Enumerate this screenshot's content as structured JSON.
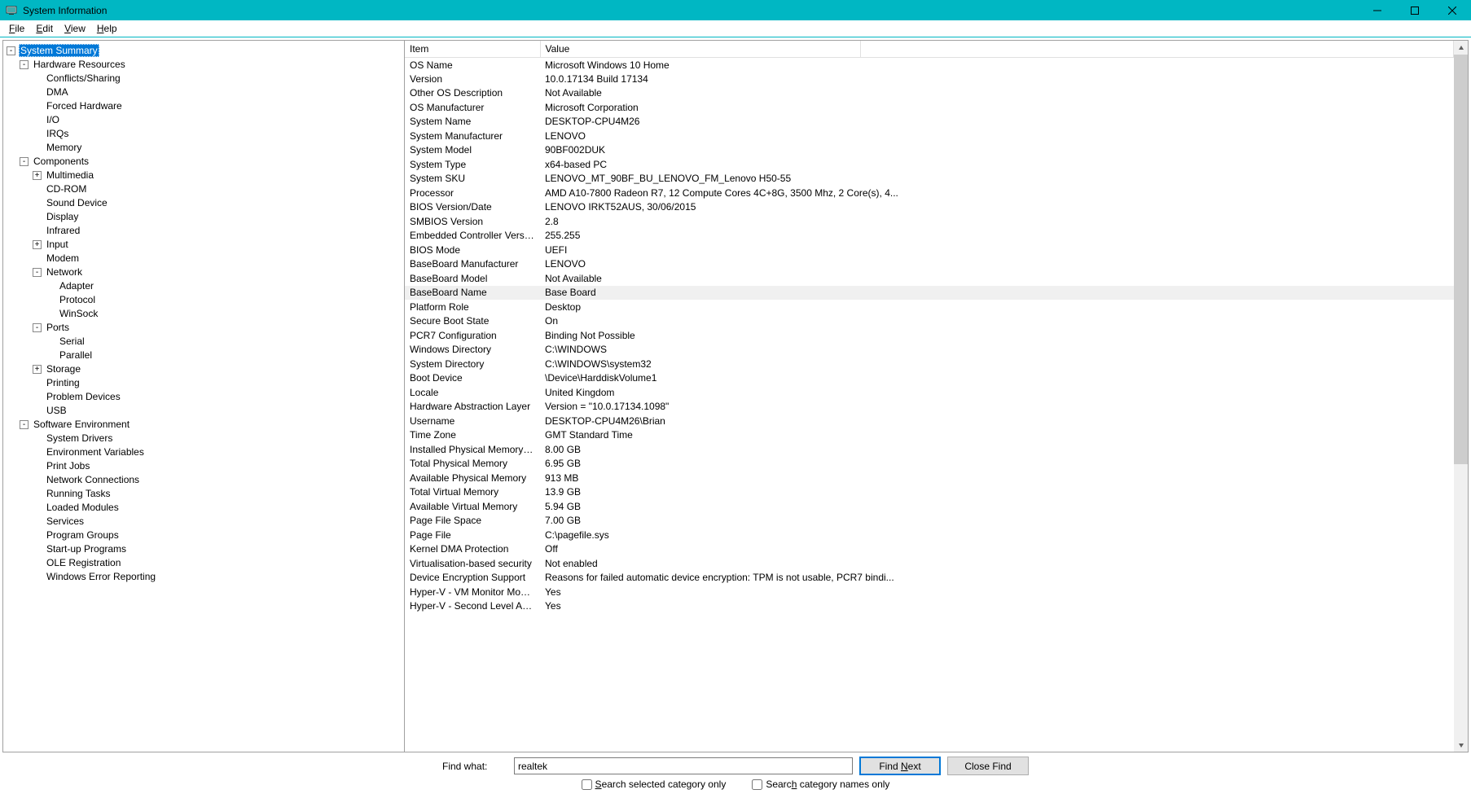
{
  "window": {
    "title": "System Information"
  },
  "menu": {
    "file": "File",
    "edit": "Edit",
    "view": "View",
    "help": "Help"
  },
  "tree": [
    {
      "depth": 0,
      "expander": "-",
      "label": "System Summary",
      "selected": true
    },
    {
      "depth": 1,
      "expander": "-",
      "label": "Hardware Resources"
    },
    {
      "depth": 2,
      "expander": "",
      "label": "Conflicts/Sharing"
    },
    {
      "depth": 2,
      "expander": "",
      "label": "DMA"
    },
    {
      "depth": 2,
      "expander": "",
      "label": "Forced Hardware"
    },
    {
      "depth": 2,
      "expander": "",
      "label": "I/O"
    },
    {
      "depth": 2,
      "expander": "",
      "label": "IRQs"
    },
    {
      "depth": 2,
      "expander": "",
      "label": "Memory"
    },
    {
      "depth": 1,
      "expander": "-",
      "label": "Components"
    },
    {
      "depth": 2,
      "expander": "+",
      "label": "Multimedia"
    },
    {
      "depth": 2,
      "expander": "",
      "label": "CD-ROM"
    },
    {
      "depth": 2,
      "expander": "",
      "label": "Sound Device"
    },
    {
      "depth": 2,
      "expander": "",
      "label": "Display"
    },
    {
      "depth": 2,
      "expander": "",
      "label": "Infrared"
    },
    {
      "depth": 2,
      "expander": "+",
      "label": "Input"
    },
    {
      "depth": 2,
      "expander": "",
      "label": "Modem"
    },
    {
      "depth": 2,
      "expander": "-",
      "label": "Network"
    },
    {
      "depth": 3,
      "expander": "",
      "label": "Adapter"
    },
    {
      "depth": 3,
      "expander": "",
      "label": "Protocol"
    },
    {
      "depth": 3,
      "expander": "",
      "label": "WinSock"
    },
    {
      "depth": 2,
      "expander": "-",
      "label": "Ports"
    },
    {
      "depth": 3,
      "expander": "",
      "label": "Serial"
    },
    {
      "depth": 3,
      "expander": "",
      "label": "Parallel"
    },
    {
      "depth": 2,
      "expander": "+",
      "label": "Storage"
    },
    {
      "depth": 2,
      "expander": "",
      "label": "Printing"
    },
    {
      "depth": 2,
      "expander": "",
      "label": "Problem Devices"
    },
    {
      "depth": 2,
      "expander": "",
      "label": "USB"
    },
    {
      "depth": 1,
      "expander": "-",
      "label": "Software Environment"
    },
    {
      "depth": 2,
      "expander": "",
      "label": "System Drivers"
    },
    {
      "depth": 2,
      "expander": "",
      "label": "Environment Variables"
    },
    {
      "depth": 2,
      "expander": "",
      "label": "Print Jobs"
    },
    {
      "depth": 2,
      "expander": "",
      "label": "Network Connections"
    },
    {
      "depth": 2,
      "expander": "",
      "label": "Running Tasks"
    },
    {
      "depth": 2,
      "expander": "",
      "label": "Loaded Modules"
    },
    {
      "depth": 2,
      "expander": "",
      "label": "Services"
    },
    {
      "depth": 2,
      "expander": "",
      "label": "Program Groups"
    },
    {
      "depth": 2,
      "expander": "",
      "label": "Start-up Programs"
    },
    {
      "depth": 2,
      "expander": "",
      "label": "OLE Registration"
    },
    {
      "depth": 2,
      "expander": "",
      "label": "Windows Error Reporting"
    }
  ],
  "details": {
    "headers": {
      "item": "Item",
      "value": "Value"
    },
    "rows": [
      {
        "item": "OS Name",
        "value": "Microsoft Windows 10 Home"
      },
      {
        "item": "Version",
        "value": "10.0.17134 Build 17134"
      },
      {
        "item": "Other OS Description",
        "value": "Not Available"
      },
      {
        "item": "OS Manufacturer",
        "value": "Microsoft Corporation"
      },
      {
        "item": "System Name",
        "value": "DESKTOP-CPU4M26"
      },
      {
        "item": "System Manufacturer",
        "value": "LENOVO"
      },
      {
        "item": "System Model",
        "value": "90BF002DUK"
      },
      {
        "item": "System Type",
        "value": "x64-based PC"
      },
      {
        "item": "System SKU",
        "value": "LENOVO_MT_90BF_BU_LENOVO_FM_Lenovo H50-55"
      },
      {
        "item": "Processor",
        "value": "AMD A10-7800 Radeon R7, 12 Compute Cores 4C+8G, 3500 Mhz, 2 Core(s), 4..."
      },
      {
        "item": "BIOS Version/Date",
        "value": "LENOVO IRKT52AUS, 30/06/2015"
      },
      {
        "item": "SMBIOS Version",
        "value": "2.8"
      },
      {
        "item": "Embedded Controller Version",
        "value": "255.255"
      },
      {
        "item": "BIOS Mode",
        "value": "UEFI"
      },
      {
        "item": "BaseBoard Manufacturer",
        "value": "LENOVO"
      },
      {
        "item": "BaseBoard Model",
        "value": "Not Available"
      },
      {
        "item": "BaseBoard Name",
        "value": "Base Board",
        "highlight": true
      },
      {
        "item": "Platform Role",
        "value": "Desktop"
      },
      {
        "item": "Secure Boot State",
        "value": "On"
      },
      {
        "item": "PCR7 Configuration",
        "value": "Binding Not Possible"
      },
      {
        "item": "Windows Directory",
        "value": "C:\\WINDOWS"
      },
      {
        "item": "System Directory",
        "value": "C:\\WINDOWS\\system32"
      },
      {
        "item": "Boot Device",
        "value": "\\Device\\HarddiskVolume1"
      },
      {
        "item": "Locale",
        "value": "United Kingdom"
      },
      {
        "item": "Hardware Abstraction Layer",
        "value": "Version = \"10.0.17134.1098\""
      },
      {
        "item": "Username",
        "value": "DESKTOP-CPU4M26\\Brian"
      },
      {
        "item": "Time Zone",
        "value": "GMT Standard Time"
      },
      {
        "item": "Installed Physical Memory (RAM)",
        "value": "8.00 GB"
      },
      {
        "item": "Total Physical Memory",
        "value": "6.95 GB"
      },
      {
        "item": "Available Physical Memory",
        "value": "913 MB"
      },
      {
        "item": "Total Virtual Memory",
        "value": "13.9 GB"
      },
      {
        "item": "Available Virtual Memory",
        "value": "5.94 GB"
      },
      {
        "item": "Page File Space",
        "value": "7.00 GB"
      },
      {
        "item": "Page File",
        "value": "C:\\pagefile.sys"
      },
      {
        "item": "Kernel DMA Protection",
        "value": "Off"
      },
      {
        "item": "Virtualisation-based security",
        "value": "Not enabled"
      },
      {
        "item": "Device Encryption Support",
        "value": "Reasons for failed automatic device encryption: TPM is not usable, PCR7 bindi..."
      },
      {
        "item": "Hyper-V - VM Monitor Mode E...",
        "value": "Yes"
      },
      {
        "item": "Hyper-V - Second Level Addres...",
        "value": "Yes"
      }
    ]
  },
  "find": {
    "label": "Find what:",
    "value": "realtek",
    "find_next": "Find Next",
    "close_find": "Close Find",
    "search_selected": "Search selected category only",
    "search_names": "Search category names only"
  }
}
